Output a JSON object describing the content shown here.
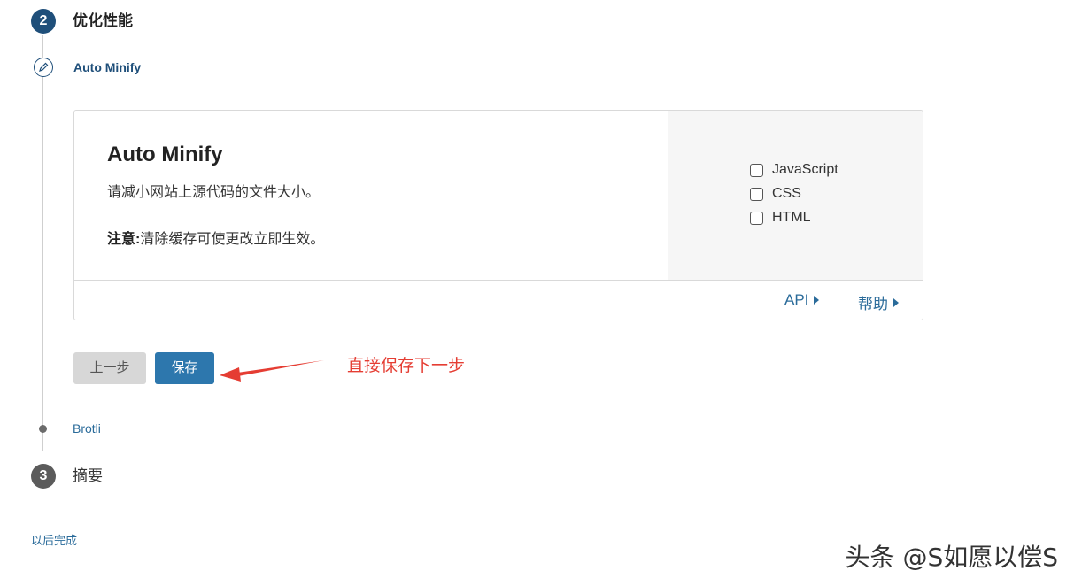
{
  "wizard": {
    "step2": {
      "number": "2",
      "title": "优化性能"
    },
    "step3": {
      "number": "3",
      "title": "摘要"
    },
    "substeps": {
      "active": "Auto Minify",
      "next": "Brotli"
    }
  },
  "card": {
    "title": "Auto Minify",
    "description": "请减小网站上源代码的文件大小。",
    "note_label": "注意:",
    "note_text": "清除缓存可使更改立即生效。",
    "options": [
      {
        "label": "JavaScript",
        "checked": false
      },
      {
        "label": "CSS",
        "checked": false
      },
      {
        "label": "HTML",
        "checked": false
      }
    ],
    "footer": {
      "api_label": "API",
      "help_label": "帮助"
    }
  },
  "buttons": {
    "prev_label": "上一步",
    "save_label": "保存"
  },
  "annotation": {
    "text": "直接保存下一步",
    "color": "#e53d33"
  },
  "later_link": "以后完成",
  "watermark": "头条 @S如愿以偿S",
  "colors": {
    "primary": "#2d77ad",
    "dark_blue": "#1f4f7a",
    "link": "#2a6b9a"
  }
}
